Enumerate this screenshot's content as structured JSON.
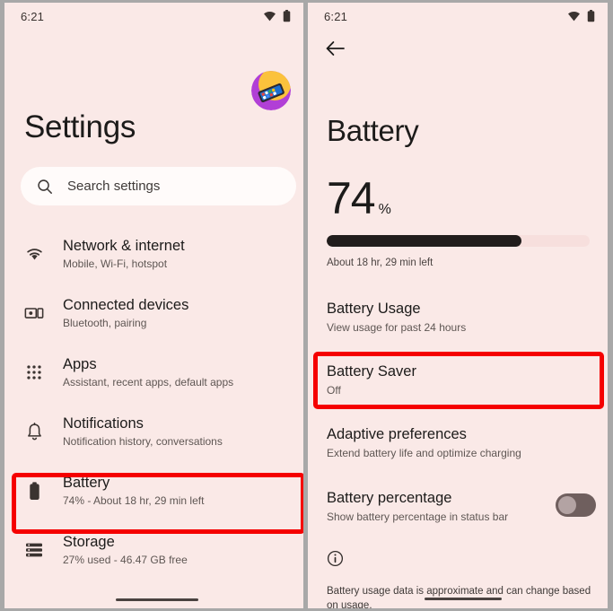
{
  "left_panel": {
    "status_bar": {
      "time": "6:21",
      "wifi_icon": "wifi-icon",
      "battery_icon": "battery-status-icon"
    },
    "avatar": "account-avatar",
    "title": "Settings",
    "search": {
      "icon": "search-icon",
      "placeholder": "Search settings"
    },
    "items": [
      {
        "icon": "wifi-icon",
        "title": "Network & internet",
        "subtitle": "Mobile, Wi-Fi, hotspot"
      },
      {
        "icon": "connected-devices-icon",
        "title": "Connected devices",
        "subtitle": "Bluetooth, pairing"
      },
      {
        "icon": "apps-grid-icon",
        "title": "Apps",
        "subtitle": "Assistant, recent apps, default apps"
      },
      {
        "icon": "bell-icon",
        "title": "Notifications",
        "subtitle": "Notification history, conversations"
      },
      {
        "icon": "battery-icon",
        "title": "Battery",
        "subtitle": "74% - About 18 hr, 29 min left"
      },
      {
        "icon": "storage-icon",
        "title": "Storage",
        "subtitle": "27% used - 46.47 GB free"
      }
    ]
  },
  "right_panel": {
    "status_bar": {
      "time": "6:21",
      "wifi_icon": "wifi-icon",
      "battery_icon": "battery-status-icon"
    },
    "back_icon": "back-arrow-icon",
    "title": "Battery",
    "percentage_value": "74",
    "percentage_symbol": "%",
    "percentage_number": 74,
    "time_remaining": "About 18 hr, 29 min left",
    "items": [
      {
        "title": "Battery Usage",
        "subtitle": "View usage for past 24 hours"
      },
      {
        "title": "Battery Saver",
        "subtitle": "Off"
      },
      {
        "title": "Adaptive preferences",
        "subtitle": "Extend battery life and optimize charging"
      },
      {
        "title": "Battery percentage",
        "subtitle": "Show battery percentage in status bar"
      }
    ],
    "toggle_state": "off",
    "info_icon": "info-icon",
    "footer_note": "Battery usage data is approximate and can change based on usage."
  },
  "highlights": {
    "color": "#f50000",
    "left_target": "Battery",
    "right_target": "Battery Saver"
  },
  "colors": {
    "background": "#fae9e7",
    "search_field": "#fffbfa",
    "bar_fill": "#211d1c",
    "bar_track": "#f7dfdd",
    "toggle_track": "#6f5f5e",
    "toggle_knob": "#b3a3a3",
    "text_primary": "#1c1b1a",
    "text_secondary": "#5e5653",
    "frame": "#a8a8a8"
  }
}
